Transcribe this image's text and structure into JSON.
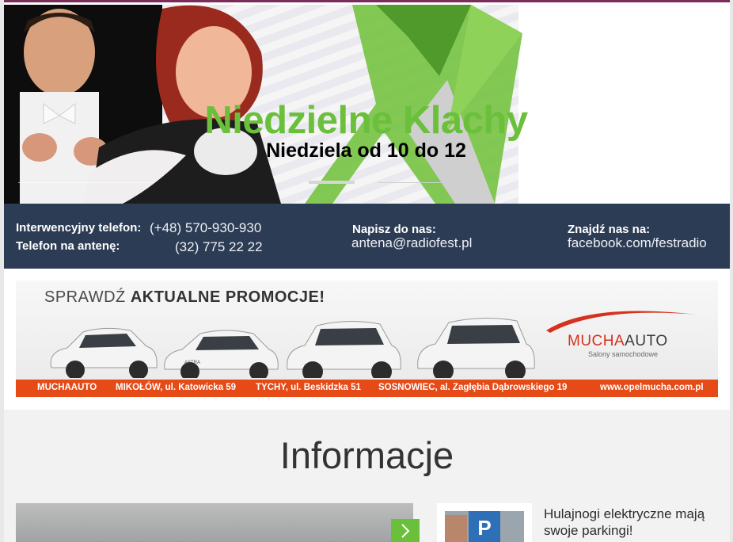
{
  "hero": {
    "title": "Niedzielne Klachy",
    "subtitle": "Niedziela od 10 do 12",
    "accent_color": "#6abf3b"
  },
  "contact": {
    "hotline_label": "Interwencyjny telefon:",
    "hotline_value": "(+48) 570-930-930",
    "onair_label": "Telefon na antenę:",
    "onair_value": "(32) 775 22 22",
    "write_label": "Napisz do nas:",
    "write_value": "antena@radiofest.pl",
    "find_label": "Znajdź nas na:",
    "find_value": "facebook.com/festradio",
    "background": "#2d3c55"
  },
  "ad": {
    "headline_prefix": "SPRAWDŹ",
    "headline_bold": "AKTUALNE PROMOCJE!",
    "car_badges": [
      "",
      "ASTRA",
      "",
      ""
    ],
    "brand_a": "MUCHA",
    "brand_b": "AUTO",
    "brand_sub": "Salony samochodowe",
    "footer": [
      "MUCHAAUTO",
      "MIKOŁÓW, ul. Katowicka 59",
      "TYCHY, ul. Beskidzka 51",
      "SOSNOWIEC, al. Zagłębia Dąbrowskiego 19",
      "www.opelmucha.com.pl"
    ],
    "footer_color": "#e54a17"
  },
  "info": {
    "section_title": "Informacje",
    "next_icon": "chevron-right-icon",
    "news": [
      {
        "title": "Hulajnogi elektryczne mają swoje parkingi!"
      }
    ]
  }
}
